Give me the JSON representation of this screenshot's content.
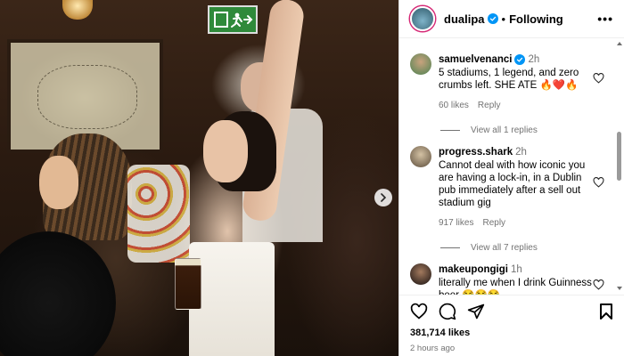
{
  "post": {
    "username": "dualipa",
    "follow_status": "Following",
    "likes": "381,714 likes",
    "time_ago": "2 hours ago"
  },
  "photo": {
    "exit_sign_icon": "exit-running-man-arrow-icon"
  },
  "comments": [
    {
      "username": "samuelvenanci",
      "verified": true,
      "time": "2h",
      "text": "5 stadiums, 1 legend, and zero crumbs left. SHE ATE 🔥❤️🔥",
      "likes": "60 likes",
      "reply": "Reply",
      "view_replies": "View all 1 replies",
      "avatar_color": "#6b8a5c"
    },
    {
      "username": "progress.shark",
      "verified": false,
      "time": "2h",
      "text": "Cannot deal with how iconic you are having a lock-in, in a Dublin pub immediately after a sell out stadium gig",
      "likes": "917 likes",
      "reply": "Reply",
      "view_replies": "View all 7 replies",
      "avatar_color": "#7a6a55"
    },
    {
      "username": "makeupongigi",
      "verified": false,
      "time": "1h",
      "text": "literally me when I drink Guinness beer 😂😂😂",
      "avatar_color": "#3a2b24"
    }
  ],
  "colors": {
    "verified": "#0095f6",
    "muted_text": "#737373",
    "divider": "#dbdbdb"
  }
}
